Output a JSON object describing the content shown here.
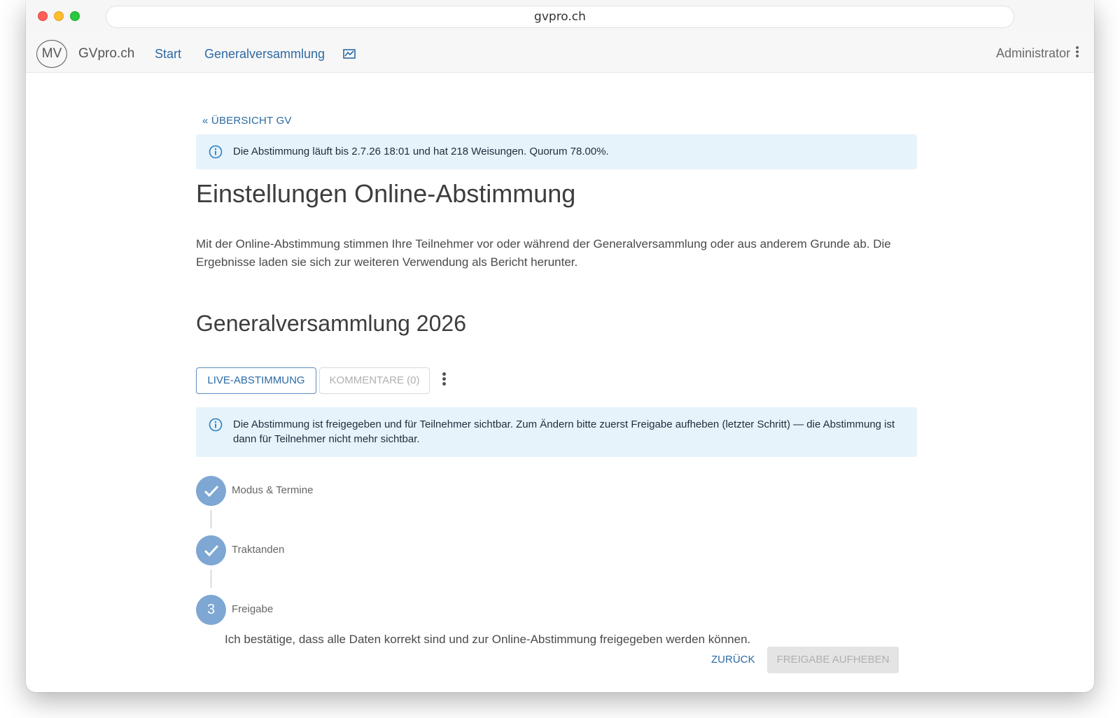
{
  "browser": {
    "url": "gvpro.ch"
  },
  "nav": {
    "avatar": "MV",
    "brand": "GVpro.ch",
    "links": [
      {
        "label": "Start"
      },
      {
        "label": "Generalversammlung"
      }
    ],
    "chart_icon": "chart-icon",
    "user": "Administrator"
  },
  "page": {
    "back_link": "« ÜBERSICHT GV",
    "status_alert": "Die Abstimmung läuft bis 2.7.26 18:01 und hat 218 Weisungen. Quorum 78.00%.",
    "title": "Einstellungen Online-Abstimmung",
    "description": "Mit der Online-Abstimmung stimmen Ihre Teilnehmer vor oder während der Generalversammlung oder aus anderem Grunde ab. Die Ergebnisse laden sie sich zur weiteren Verwendung als Bericht herunter.",
    "event_title": "Generalversammlung 2026",
    "buttons": {
      "live": "LIVE-ABSTIMMUNG",
      "comments": "KOMMENTARE (0)"
    },
    "release_alert": "Die Abstimmung ist freigegeben und für Teilnehmer sichtbar. Zum Ändern bitte zuerst Freigabe aufheben (letzter Schritt) — die Abstimmung ist dann für Teilnehmer nicht mehr sichtbar.",
    "steps": [
      {
        "label": "Modus & Termine",
        "state": "done"
      },
      {
        "label": "Traktanden",
        "state": "done"
      },
      {
        "label": "Freigabe",
        "number": "3",
        "state": "active"
      }
    ],
    "confirm_text": "Ich bestätige, dass alle Daten korrekt sind und zur Online-Abstimmung freigegeben werden können.",
    "back_button": "ZURÜCK",
    "release_button": "FREIGABE AUFHEBEN"
  },
  "colors": {
    "link": "#2d6aa3",
    "step": "#7ea7d3",
    "alert_bg": "#e6f3fb"
  }
}
